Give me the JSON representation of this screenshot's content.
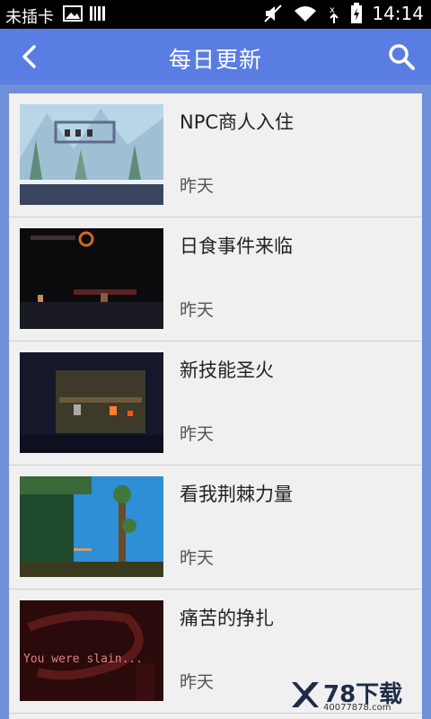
{
  "status_bar": {
    "carrier": "未插卡",
    "time": "14:14"
  },
  "header": {
    "title": "每日更新"
  },
  "list": {
    "items": [
      {
        "title": "NPC商人入住",
        "date": "昨天"
      },
      {
        "title": "日食事件来临",
        "date": "昨天"
      },
      {
        "title": "新技能圣火",
        "date": "昨天"
      },
      {
        "title": "看我荆棘力量",
        "date": "昨天"
      },
      {
        "title": "痛苦的挣扎",
        "date": "昨天"
      }
    ]
  },
  "thumbnail_texts": {
    "item_4": "You were slain..."
  },
  "watermark": {
    "brand": "78下载",
    "url": "40077878.com"
  },
  "colors": {
    "header_bg": "#5a7de3",
    "page_bg": "#6f8fd9",
    "card_bg": "#f0f0f0"
  }
}
